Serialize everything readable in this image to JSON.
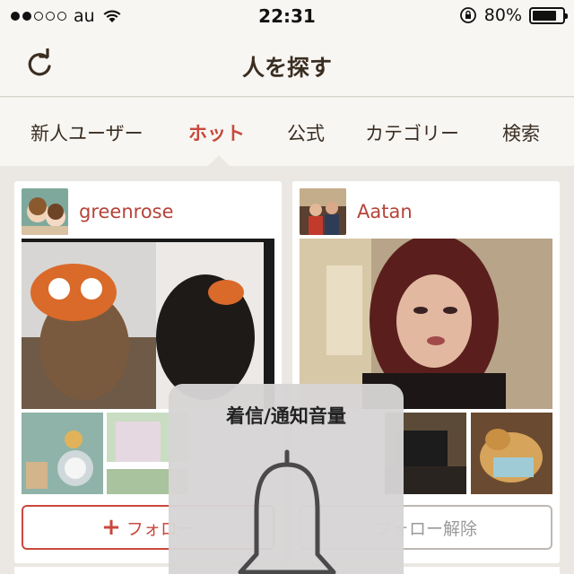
{
  "status_bar": {
    "carrier": "au",
    "time": "22:31",
    "battery_percent": "80%",
    "battery_level": 0.8,
    "signal_bars_filled": 2,
    "signal_bars_total": 5
  },
  "nav": {
    "title": "人を探す",
    "refresh_icon": "refresh-icon"
  },
  "tabs": [
    {
      "label": "新人ユーザー",
      "active": false
    },
    {
      "label": "ホット",
      "active": true
    },
    {
      "label": "公式",
      "active": false
    },
    {
      "label": "カテゴリー",
      "active": false
    },
    {
      "label": "検索",
      "active": false
    }
  ],
  "cards": [
    {
      "username": "greenrose",
      "button_label": "フォロー",
      "button_icon": "plus-icon"
    },
    {
      "username": "Aatan",
      "button_label": "フォロー解除"
    }
  ],
  "volume_hud": {
    "title": "着信/通知音量",
    "icon": "bell-icon"
  },
  "colors": {
    "accent": "#c9483c",
    "background": "#ebe8e3",
    "header": "#f8f6f3"
  }
}
